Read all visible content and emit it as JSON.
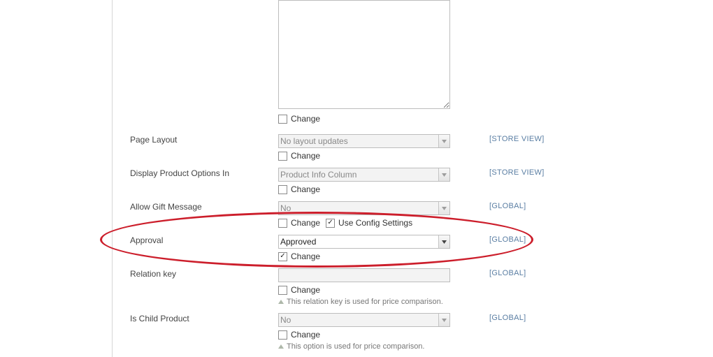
{
  "change_label": "Change",
  "use_config_label": "Use Config Settings",
  "rows": {
    "textarea": {
      "value": ""
    },
    "page_layout": {
      "label": "Page Layout",
      "value": "No layout updates",
      "scope": "[STORE VIEW]",
      "change": false
    },
    "display_options": {
      "label": "Display Product Options In",
      "value": "Product Info Column",
      "scope": "[STORE VIEW]",
      "change": false
    },
    "gift_message": {
      "label": "Allow Gift Message",
      "value": "No",
      "scope": "[GLOBAL]",
      "change": false,
      "use_config": true
    },
    "approval": {
      "label": "Approval",
      "value": "Approved",
      "scope": "[GLOBAL]",
      "change": true
    },
    "relation_key": {
      "label": "Relation key",
      "value": "",
      "scope": "[GLOBAL]",
      "change": false,
      "hint": "This relation key is used for price comparison."
    },
    "is_child": {
      "label": "Is Child Product",
      "value": "No",
      "scope": "[GLOBAL]",
      "change": false,
      "hint": "This option is used for price comparison."
    }
  }
}
